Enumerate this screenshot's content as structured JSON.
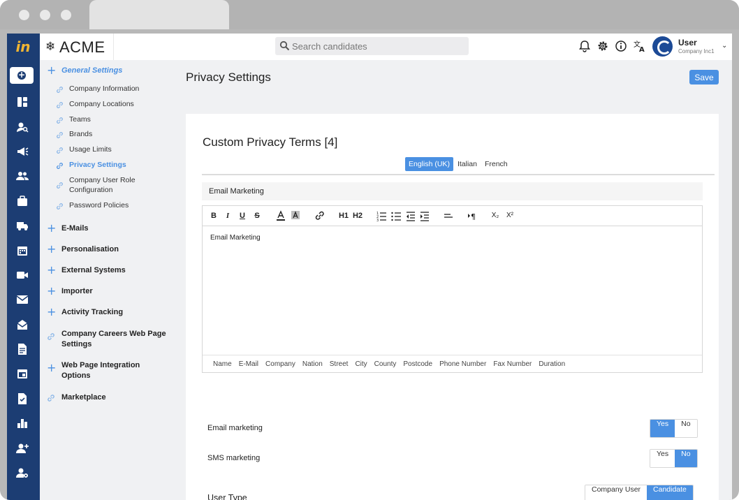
{
  "header": {
    "brand_name": "ACME",
    "search": {
      "placeholder": "Search candidates"
    },
    "user": {
      "name": "User",
      "company": "Company Inc1"
    }
  },
  "rail": {
    "icons": [
      "dashboard-icon",
      "candidate-search-icon",
      "campaign-icon",
      "people-icon",
      "briefcase-icon",
      "truck-icon",
      "calendar-icon",
      "video-icon",
      "mail-icon",
      "inbox-icon",
      "document-icon",
      "event-icon",
      "checklist-icon",
      "bar-chart-icon",
      "add-user-icon",
      "user-settings-icon"
    ]
  },
  "sidebar": {
    "general": {
      "label": "General Settings",
      "items": [
        {
          "label": "Company Information"
        },
        {
          "label": "Company Locations"
        },
        {
          "label": "Teams"
        },
        {
          "label": "Brands"
        },
        {
          "label": "Usage Limits"
        },
        {
          "label": "Privacy Settings"
        },
        {
          "label": "Company User Role Configuration"
        },
        {
          "label": "Password Policies"
        }
      ]
    },
    "groups": [
      {
        "label": "E-Mails"
      },
      {
        "label": "Personalisation"
      },
      {
        "label": "External Systems"
      },
      {
        "label": "Importer"
      },
      {
        "label": "Activity Tracking"
      },
      {
        "label": "Company Careers Web Page Settings"
      },
      {
        "label": "Web Page Integration Options"
      },
      {
        "label": "Marketplace"
      }
    ]
  },
  "main": {
    "title": "Privacy Settings",
    "save_label": "Save",
    "card_title": "Custom Privacy Terms [4]",
    "languages": [
      "English (UK)",
      "Italian",
      "French"
    ],
    "field_name": "Email Marketing",
    "toolbar": {
      "bold": "B",
      "italic": "I",
      "underline": "U",
      "strike": "S",
      "h1": "H1",
      "h2": "H2",
      "sub": "X₂",
      "sup": "X²"
    },
    "editor_text": "Email Marketing",
    "placeholders": [
      "Name",
      "E-Mail",
      "Company",
      "Nation",
      "Street",
      "City",
      "County",
      "Postcode",
      "Phone Number",
      "Fax Number",
      "Duration"
    ],
    "email_marketing": {
      "label": "Email marketing",
      "yes": "Yes",
      "no": "No"
    },
    "sms_marketing": {
      "label": "SMS marketing",
      "yes": "Yes",
      "no": "No"
    },
    "user_type": {
      "label": "User Type",
      "option_a": "Company User",
      "option_b": "Candidate"
    }
  }
}
